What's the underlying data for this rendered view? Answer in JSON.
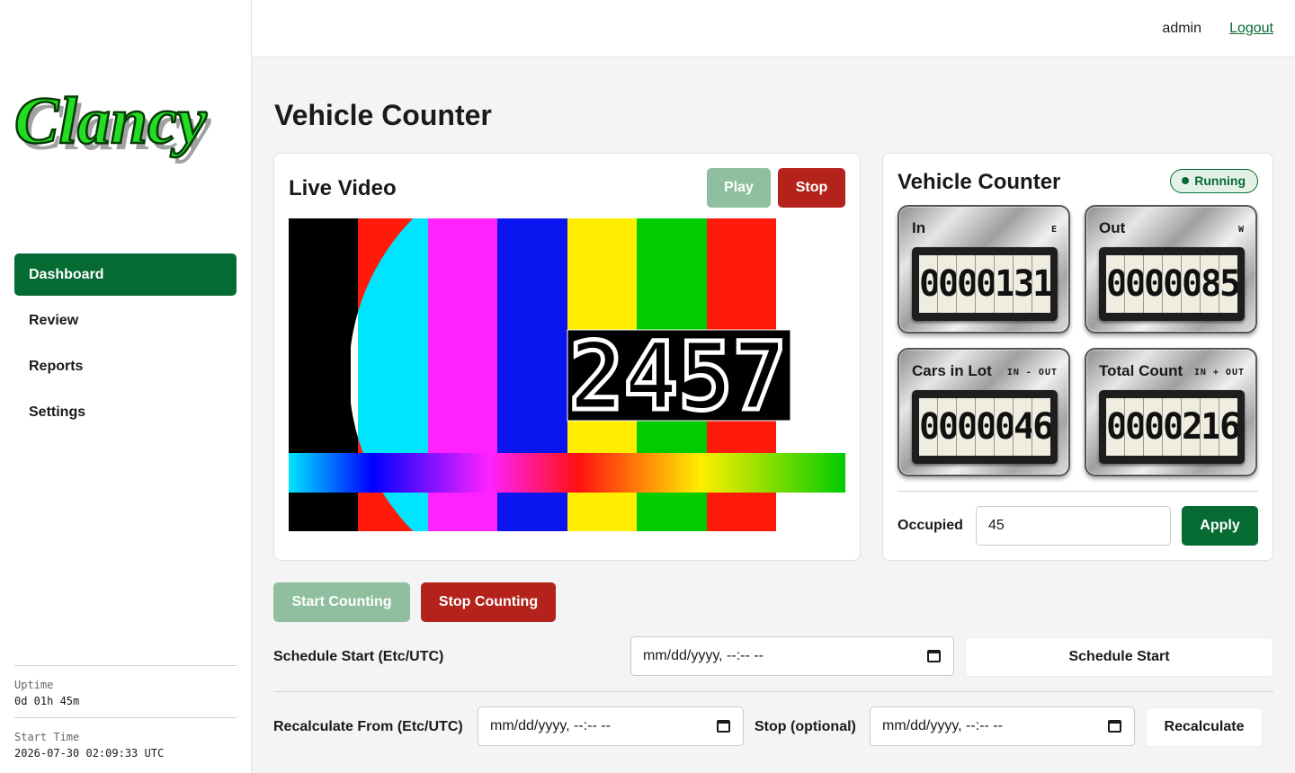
{
  "brand": {
    "logo_text": "Clancy"
  },
  "nav": {
    "items": [
      {
        "label": "Dashboard",
        "active": true
      },
      {
        "label": "Review",
        "active": false
      },
      {
        "label": "Reports",
        "active": false
      },
      {
        "label": "Settings",
        "active": false
      }
    ]
  },
  "sidebar_meta": {
    "uptime_label": "Uptime",
    "uptime_value": "0d 01h 45m",
    "start_label": "Start Time",
    "start_value": "2026-07-30 02:09:33 UTC"
  },
  "header": {
    "user": "admin",
    "logout_label": "Logout"
  },
  "page": {
    "title": "Vehicle Counter"
  },
  "video": {
    "title": "Live Video",
    "play_label": "Play",
    "stop_label": "Stop",
    "overlay_text": "2457"
  },
  "counter": {
    "title": "Vehicle Counter",
    "status": "Running",
    "tiles": [
      {
        "label": "In",
        "sub": "E",
        "value": "0000131"
      },
      {
        "label": "Out",
        "sub": "W",
        "value": "0000085"
      },
      {
        "label": "Cars in Lot",
        "sub": "IN - OUT",
        "value": "0000046"
      },
      {
        "label": "Total Count",
        "sub": "IN + OUT",
        "value": "0000216"
      }
    ],
    "occupied_label": "Occupied",
    "occupied_value": "45",
    "apply_label": "Apply"
  },
  "controls": {
    "start_counting": "Start Counting",
    "stop_counting": "Stop Counting",
    "schedule_label": "Schedule Start (Etc/UTC)",
    "schedule_placeholder": "mm/dd/yyyy, --:-- --",
    "schedule_button": "Schedule Start",
    "recalc_label": "Recalculate From (Etc/UTC)",
    "recalc_placeholder": "mm/dd/yyyy, --:-- --",
    "stop_optional_label": "Stop (optional)",
    "stop_placeholder": "mm/dd/yyyy, --:-- --",
    "recalc_button": "Recalculate"
  },
  "colors": {
    "accent": "#066b33",
    "danger": "#b3221b",
    "disabled_green": "#8fbf9e",
    "logo_green": "#22dd22"
  }
}
